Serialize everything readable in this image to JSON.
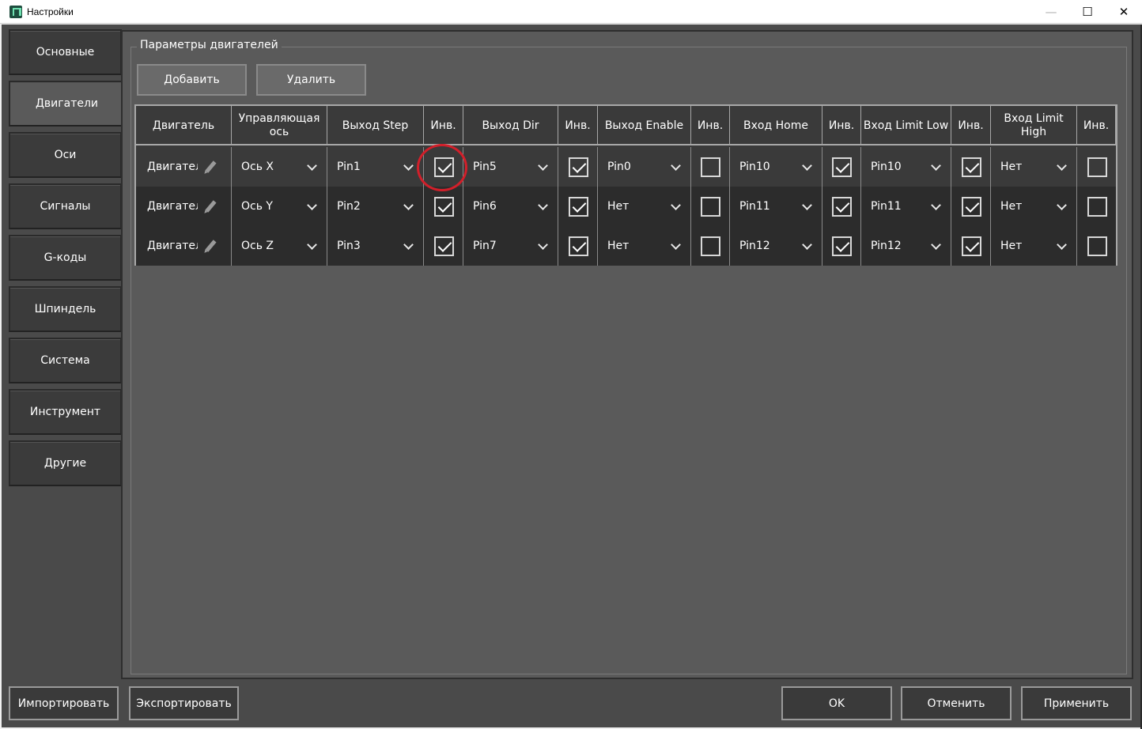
{
  "window": {
    "title": "Настройки",
    "minimize": "—",
    "maximize": "☐",
    "close": "✕"
  },
  "nav": {
    "items": [
      {
        "label": "Основные",
        "active": false
      },
      {
        "label": "Двигатели",
        "active": true
      },
      {
        "label": "Оси",
        "active": false
      },
      {
        "label": "Сигналы",
        "active": false
      },
      {
        "label": "G-коды",
        "active": false
      },
      {
        "label": "Шпиндель",
        "active": false
      },
      {
        "label": "Система",
        "active": false
      },
      {
        "label": "Инструмент",
        "active": false
      },
      {
        "label": "Другие",
        "active": false
      }
    ]
  },
  "group": {
    "title": "Параметры двигателей"
  },
  "toolbar": {
    "add_label": "Добавить",
    "remove_label": "Удалить"
  },
  "table": {
    "headers": [
      "Двигатель",
      "Управляющая ось",
      "Выход Step",
      "Инв.",
      "Выход Dir",
      "Инв.",
      "Выход Enable",
      "Инв.",
      "Вход Home",
      "Инв.",
      "Вход Limit Low",
      "Инв.",
      "Вход Limit High",
      "Инв."
    ],
    "rows": [
      {
        "name": "Двигатель",
        "axis": "Ось X",
        "step": "Pin1",
        "step_inv": true,
        "dir": "Pin5",
        "dir_inv": true,
        "enable": "Pin0",
        "enable_inv": false,
        "home": "Pin10",
        "home_inv": true,
        "limit_low": "Pin10",
        "limit_low_inv": true,
        "limit_high": "Нет",
        "limit_high_inv": false
      },
      {
        "name": "Двигатель",
        "axis": "Ось Y",
        "step": "Pin2",
        "step_inv": true,
        "dir": "Pin6",
        "dir_inv": true,
        "enable": "Нет",
        "enable_inv": false,
        "home": "Pin11",
        "home_inv": true,
        "limit_low": "Pin11",
        "limit_low_inv": true,
        "limit_high": "Нет",
        "limit_high_inv": false
      },
      {
        "name": "Двигатель",
        "axis": "Ось Z",
        "step": "Pin3",
        "step_inv": true,
        "dir": "Pin7",
        "dir_inv": true,
        "enable": "Нет",
        "enable_inv": false,
        "home": "Pin12",
        "home_inv": true,
        "limit_low": "Pin12",
        "limit_low_inv": true,
        "limit_high": "Нет",
        "limit_high_inv": false
      }
    ]
  },
  "footer": {
    "import_label": "Импортировать",
    "export_label": "Экспортировать",
    "ok_label": "OK",
    "cancel_label": "Отменить",
    "apply_label": "Применить"
  },
  "colors": {
    "background": "#4a4a4a",
    "panel": "#5a5a5a",
    "highlight": "#d21f2a"
  }
}
